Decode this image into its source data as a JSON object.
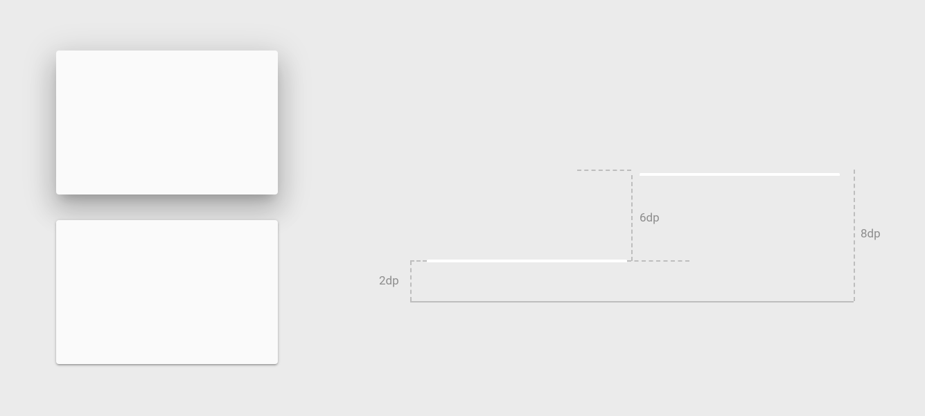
{
  "diagram": {
    "label_2dp": "2dp",
    "label_6dp": "6dp",
    "label_8dp": "8dp"
  }
}
